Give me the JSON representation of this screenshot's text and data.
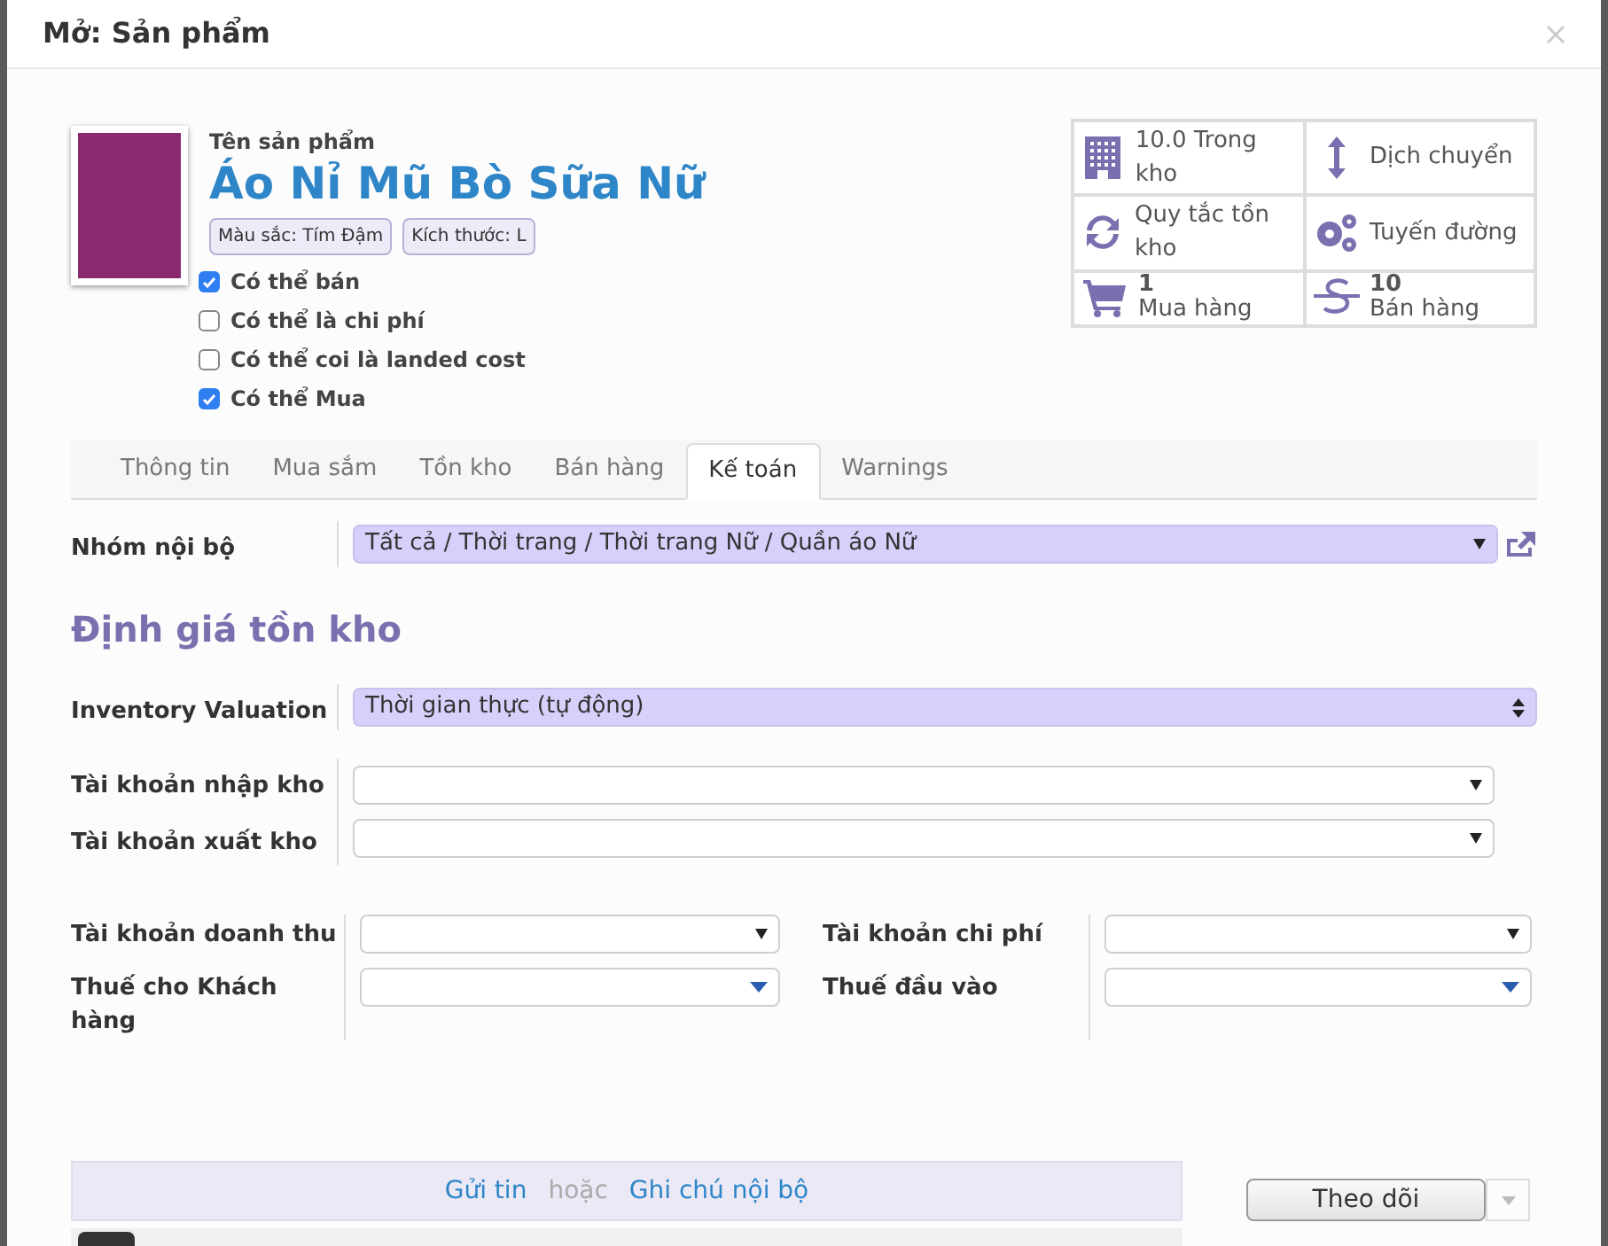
{
  "window": {
    "title": "Mở: Sản phẩm"
  },
  "product": {
    "name_label": "Tên sản phẩm",
    "name": "Áo Nỉ Mũ Bò Sữa Nữ",
    "attributes": [
      "Màu sắc: Tím Đậm",
      "Kích thước: L"
    ],
    "options": [
      {
        "label": "Có thể bán",
        "checked": true
      },
      {
        "label": "Có thể là chi phí",
        "checked": false
      },
      {
        "label": "Có thể coi là landed cost",
        "checked": false
      },
      {
        "label": "Có thể Mua",
        "checked": true
      }
    ]
  },
  "stat_buttons": [
    {
      "kind": "building",
      "label": "10.0 Trong kho"
    },
    {
      "kind": "updown",
      "label": "Dịch chuyển"
    },
    {
      "kind": "refresh",
      "label": "Quy tắc tồn kho"
    },
    {
      "kind": "gears",
      "label": "Tuyến đường"
    },
    {
      "kind": "cart",
      "value": "1",
      "label": "Mua hàng"
    },
    {
      "kind": "dollar",
      "value": "10",
      "label": "Bán hàng"
    }
  ],
  "tabs": [
    {
      "label": "Thông tin",
      "selected": false
    },
    {
      "label": "Mua sắm",
      "selected": false
    },
    {
      "label": "Tồn kho",
      "selected": false
    },
    {
      "label": "Bán hàng",
      "selected": false
    },
    {
      "label": "Kế toán",
      "selected": true
    },
    {
      "label": "Warnings",
      "selected": false
    }
  ],
  "internal_category": {
    "label": "Nhóm nội bộ",
    "value": "Tất cả / Thời trang / Thời trang Nữ / Quần áo Nữ"
  },
  "section_title": "Định giá tồn kho",
  "valuation": {
    "label": "Inventory Valuation",
    "value": "Thời gian thực (tự động)"
  },
  "stock_accounts": [
    {
      "label": "Tài khoản nhập kho"
    },
    {
      "label": "Tài khoản xuất kho"
    }
  ],
  "left_fields": [
    {
      "label": "Tài khoản doanh thu",
      "kind": "account"
    },
    {
      "label": "Thuế cho Khách hàng",
      "kind": "tax"
    }
  ],
  "right_fields": [
    {
      "label": "Tài khoản chi phí",
      "kind": "account"
    },
    {
      "label": "Thuế đầu vào",
      "kind": "tax"
    }
  ],
  "chatter": {
    "send": "Gửi tin",
    "or": "hoặc",
    "note": "Ghi chú nội bộ",
    "follow": "Theo dõi"
  }
}
